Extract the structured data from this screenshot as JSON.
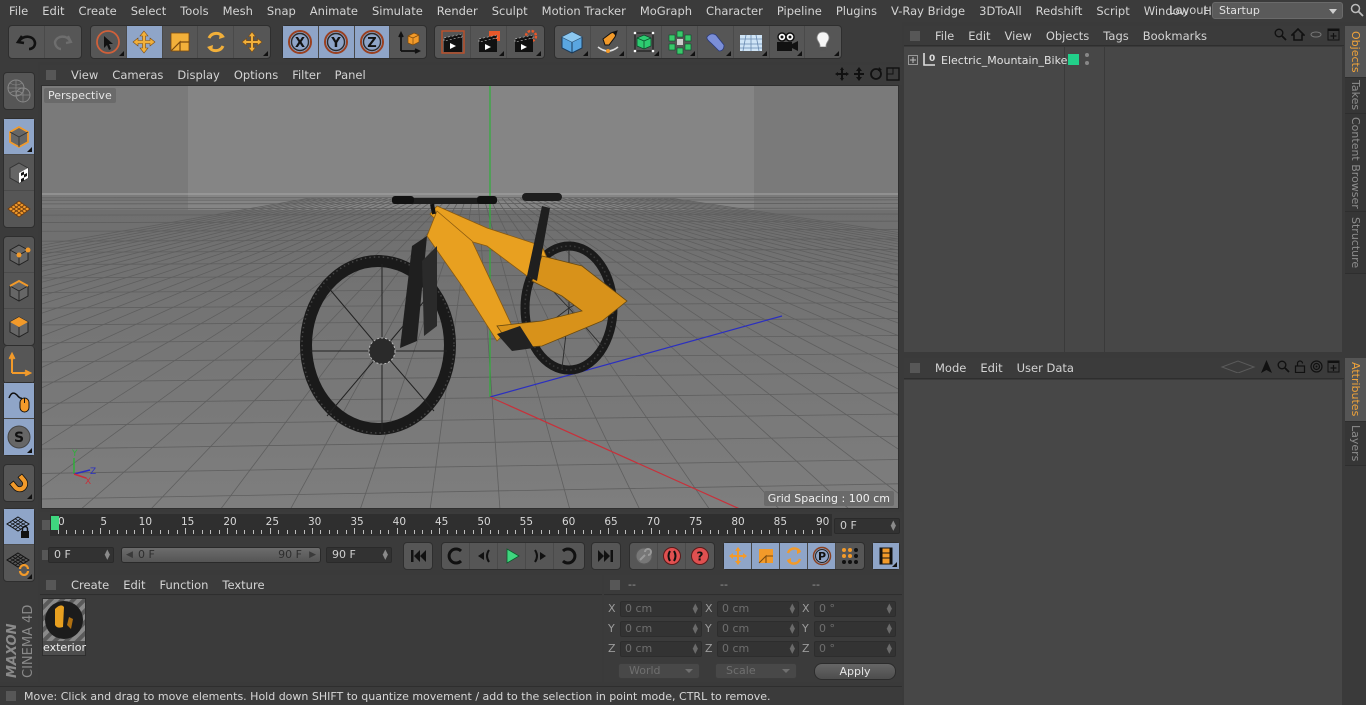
{
  "menubar": {
    "items": [
      "File",
      "Edit",
      "Create",
      "Select",
      "Tools",
      "Mesh",
      "Snap",
      "Animate",
      "Simulate",
      "Render",
      "Sculpt",
      "Motion Tracker",
      "MoGraph",
      "Character",
      "Pipeline",
      "Plugins",
      "V-Ray Bridge",
      "3DToAll",
      "Redshift",
      "Script",
      "Window",
      "Help"
    ],
    "layout_label": "Layout:",
    "layout_value": "Startup"
  },
  "toolbar": {
    "groups": [
      [
        "undo-icon",
        "redo-icon"
      ],
      [
        "live-selection-icon",
        "move-icon",
        "scale-icon",
        "rotate-icon",
        "transform-icon"
      ],
      [
        "x-axis-lock-icon",
        "y-axis-lock-icon",
        "z-axis-lock-icon",
        "coordinate-system-icon"
      ],
      [
        "render-view-icon",
        "render-to-picture-viewer-icon",
        "render-settings-icon"
      ],
      [
        "cube-icon",
        "pen-spline-icon",
        "subdivision-surface-icon",
        "cloner-icon",
        "deformer-icon",
        "floor-icon",
        "camera-icon",
        "light-icon"
      ]
    ],
    "active": [
      "move-icon",
      "x-axis-lock-icon",
      "y-axis-lock-icon",
      "z-axis-lock-icon"
    ]
  },
  "left_toolbar": {
    "items": [
      "make-editable-icon",
      "model-mode-icon",
      "texture-mode-icon",
      "workplane-mode-icon",
      "points-mode-icon",
      "edges-mode-icon",
      "polygons-mode-icon",
      "axis-mode-icon",
      "tweak-mode-icon",
      "solo-icon",
      "snap-icon",
      "workplane-lock-icon",
      "workplane-align-icon"
    ],
    "active": [
      "model-mode-icon",
      "tweak-mode-icon",
      "solo-icon",
      "workplane-lock-icon"
    ],
    "brand_top": "MAXON",
    "brand_bottom": "CINEMA 4D"
  },
  "viewport": {
    "menu": [
      "View",
      "Cameras",
      "Display",
      "Options",
      "Filter",
      "Panel"
    ],
    "camera_label": "Perspective",
    "grid_spacing": "Grid Spacing : 100 cm",
    "axis_labels": {
      "x": "X",
      "y": "Y",
      "z": "Z"
    },
    "colors": {
      "bg": "#7b7b7b",
      "x_axis": "#c8303a",
      "y_axis": "#2fae3a",
      "z_axis": "#2b2fc0",
      "bike_frame": "#e8a020"
    }
  },
  "timeline": {
    "ticks": [
      "0",
      "5",
      "10",
      "15",
      "20",
      "25",
      "30",
      "35",
      "40",
      "45",
      "50",
      "55",
      "60",
      "65",
      "70",
      "75",
      "80",
      "85",
      "90"
    ],
    "current_frame": "0 F",
    "start_field": "0 F",
    "range_start": "0 F",
    "range_end": "90 F",
    "end_field": "90 F",
    "playhead_color": "#3fd67f"
  },
  "playback": {
    "transport": [
      "go-to-start-icon",
      "previous-key-icon",
      "play-backwards-icon",
      "play-forwards-icon",
      "next-key-icon",
      "loop-icon",
      "go-to-end-icon"
    ],
    "keys": [
      "motion-record-icon",
      "record-active-objects-icon",
      "autokeying-icon"
    ],
    "key_types": [
      "key-position-icon",
      "key-scale-icon",
      "key-rotation-icon",
      "key-parameter-icon",
      "key-pla-icon"
    ],
    "timeline_window": "timeline-icon"
  },
  "material_manager": {
    "menu": [
      "Create",
      "Edit",
      "Function",
      "Texture"
    ],
    "materials": [
      {
        "name": "exterior"
      }
    ]
  },
  "coordinates": {
    "headers": [
      "--",
      "--",
      "--"
    ],
    "rows": [
      {
        "axis": "X",
        "pos": "0 cm",
        "size": "0 cm",
        "rot": "0 °"
      },
      {
        "axis": "Y",
        "pos": "0 cm",
        "size": "0 cm",
        "rot": "0 °"
      },
      {
        "axis": "Z",
        "pos": "0 cm",
        "size": "0 cm",
        "rot": "0 °"
      }
    ],
    "space_select": "World",
    "mode_select": "Scale",
    "apply_label": "Apply"
  },
  "status_bar": {
    "text": "Move: Click and drag to move elements. Hold down SHIFT to quantize movement / add to the selection in point mode, CTRL to remove."
  },
  "object_manager": {
    "menu": [
      "File",
      "Edit",
      "View",
      "Objects",
      "Tags",
      "Bookmarks"
    ],
    "objects": [
      {
        "name": "Electric_Mountain_Bike",
        "layer_color": "#22d08a"
      }
    ]
  },
  "attribute_manager": {
    "menu": [
      "Mode",
      "Edit",
      "User Data"
    ]
  },
  "right_tabs_top": [
    {
      "label": "Objects",
      "active": true
    },
    {
      "label": "Takes",
      "active": false
    },
    {
      "label": "Content Browser",
      "active": false
    },
    {
      "label": "Structure",
      "active": false
    }
  ],
  "right_tabs_bottom": [
    {
      "label": "Attributes",
      "active": true
    },
    {
      "label": "Layers",
      "active": false
    }
  ]
}
